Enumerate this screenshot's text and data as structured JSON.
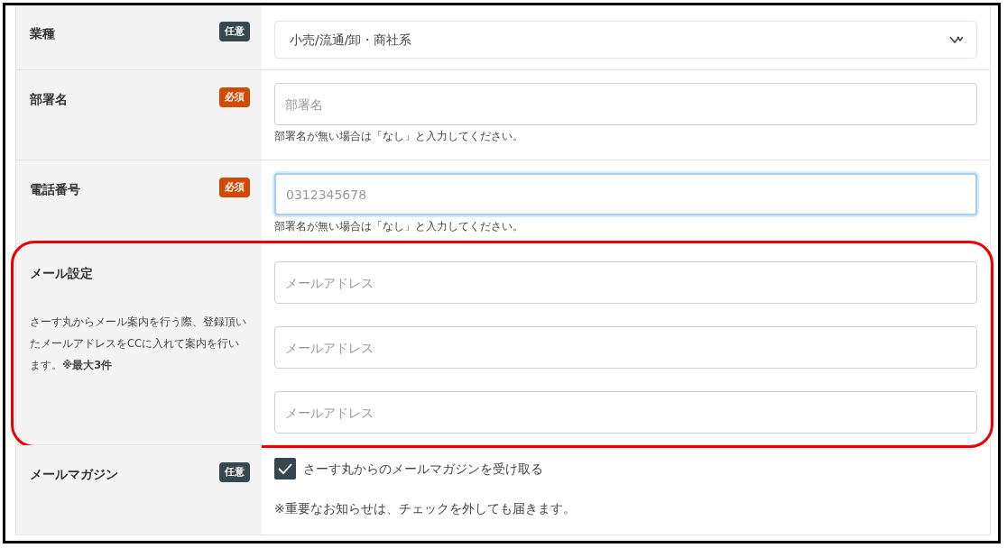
{
  "rows": [
    {
      "kind": "select",
      "label": "業種",
      "badge": {
        "text": "任意",
        "kind": "optional"
      },
      "value": "小売/流通/卸・商社系"
    },
    {
      "kind": "text",
      "label": "部署名",
      "badge": {
        "text": "必須",
        "kind": "required"
      },
      "fields": [
        {
          "placeholder": "部署名",
          "focused": false
        }
      ],
      "note": "部署名が無い場合は「なし」と入力してください。"
    },
    {
      "kind": "text",
      "label": "電話番号",
      "badge": {
        "text": "必須",
        "kind": "required"
      },
      "fields": [
        {
          "placeholder": "0312345678",
          "focused": true
        }
      ],
      "note": "部署名が無い場合は「なし」と入力してください。"
    },
    {
      "kind": "text",
      "label": "メール設定",
      "highlighted": true,
      "description": "さーす丸からメール案内を行う際、登録頂いたメールアドレスをCCに入れて案内を行います。**※最大3件**",
      "fields": [
        {
          "placeholder": "メールアドレス",
          "focused": false
        },
        {
          "placeholder": "メールアドレス",
          "focused": false
        },
        {
          "placeholder": "メールアドレス",
          "focused": false
        }
      ]
    },
    {
      "kind": "checkbox",
      "label": "メールマガジン",
      "badge": {
        "text": "任意",
        "kind": "optional"
      },
      "checkbox": {
        "label": "さーす丸からのメールマガジンを受け取る",
        "checked": true
      },
      "note": "※重要なお知らせは、チェックを外しても届きます。"
    }
  ]
}
